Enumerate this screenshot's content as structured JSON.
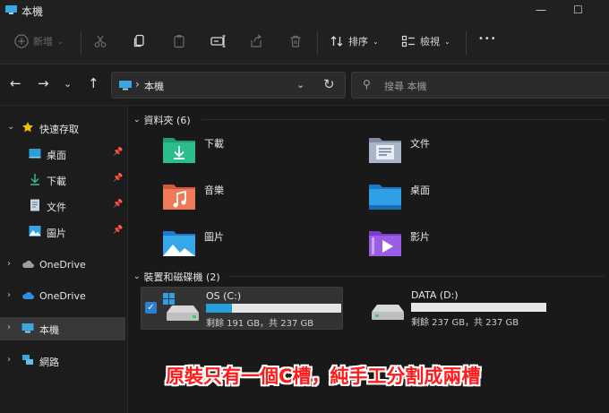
{
  "window": {
    "title": "本機",
    "minimize_glyph": "—",
    "maximize_glyph": "☐"
  },
  "toolbar": {
    "new_label": "新增",
    "new_icon": "plus-circle-icon",
    "cut_icon": "scissors-icon",
    "copy_icon": "copy-icon",
    "paste_icon": "paste-icon",
    "rename_icon": "rename-icon",
    "share_icon": "share-icon",
    "delete_icon": "trash-icon",
    "sort_label": "排序",
    "view_label": "檢視",
    "more_glyph": "•••"
  },
  "address": {
    "location": "本機",
    "search_placeholder": "搜尋 本機"
  },
  "sidebar": {
    "quick_access": {
      "label": "快速存取",
      "icon": "star-icon"
    },
    "pinned": [
      {
        "label": "桌面",
        "icon": "desktop-folder-icon"
      },
      {
        "label": "下載",
        "icon": "download-arrow-icon"
      },
      {
        "label": "文件",
        "icon": "documents-icon"
      },
      {
        "label": "圖片",
        "icon": "pictures-icon"
      }
    ],
    "roots": [
      {
        "label": "OneDrive",
        "icon": "cloud-icon"
      },
      {
        "label": "OneDrive",
        "icon": "cloud-icon"
      },
      {
        "label": "本機",
        "icon": "pc-icon"
      },
      {
        "label": "網路",
        "icon": "network-icon"
      }
    ]
  },
  "content": {
    "folders_header": "資料夾 (6)",
    "folders": [
      {
        "label": "下載",
        "icon": "downloads-folder-icon"
      },
      {
        "label": "文件",
        "icon": "documents-folder-icon"
      },
      {
        "label": "音樂",
        "icon": "music-folder-icon"
      },
      {
        "label": "桌面",
        "icon": "desktop-folder-icon"
      },
      {
        "label": "圖片",
        "icon": "pictures-folder-icon"
      },
      {
        "label": "影片",
        "icon": "videos-folder-icon"
      }
    ],
    "drives_header": "裝置和磁碟機 (2)",
    "drives": [
      {
        "name": "OS (C:)",
        "info": "剩餘 191 GB，共 237 GB",
        "free_gb": 191,
        "total_gb": 237,
        "used_fraction": 0.194,
        "selected": true
      },
      {
        "name": "DATA (D:)",
        "info": "剩餘 237 GB，共 237 GB",
        "free_gb": 237,
        "total_gb": 237,
        "used_fraction": 0.0,
        "selected": false
      }
    ]
  },
  "annotation": {
    "text": "原裝只有一個C槽，純手工分割成兩槽",
    "color": "#ff1b1b"
  },
  "colors": {
    "accent": "#26a0da",
    "selected_bg": "#383838",
    "window_bg": "#191919"
  }
}
